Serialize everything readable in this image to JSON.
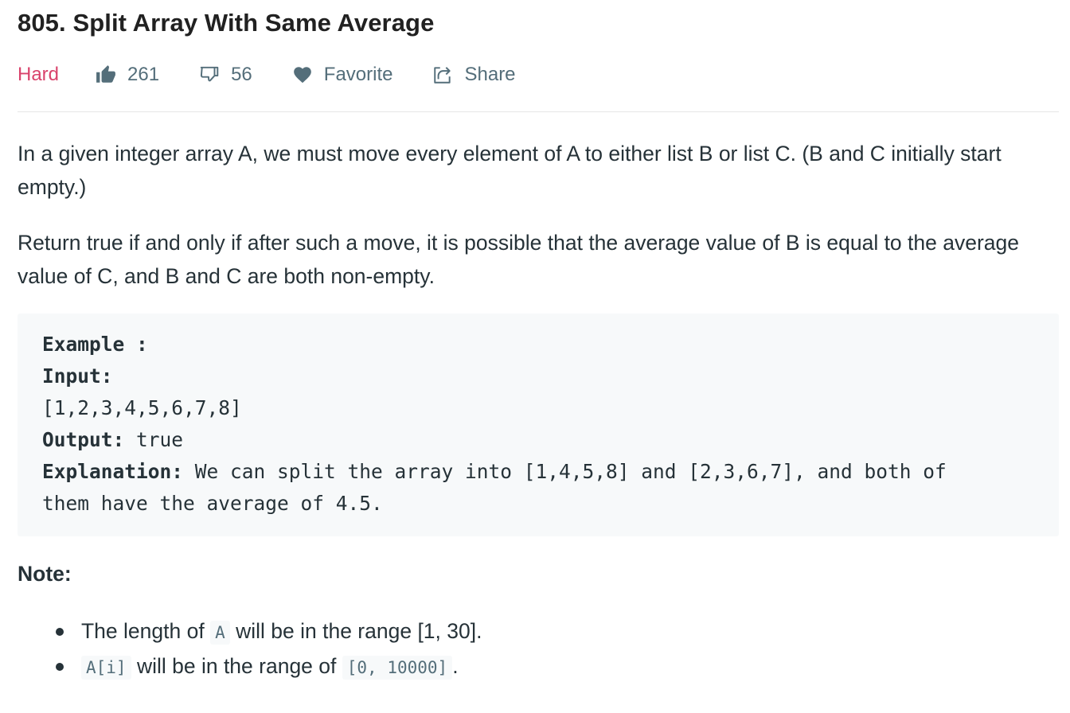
{
  "problem": {
    "title": "805. Split Array With Same Average",
    "difficulty": "Hard"
  },
  "toolbar": {
    "likes": "261",
    "dislikes": "56",
    "favorite_label": "Favorite",
    "share_label": "Share"
  },
  "colors": {
    "difficulty_hard": "#d9436c",
    "meta_text": "#546e7a",
    "body_text": "#263238",
    "code_background": "#f7f9fa"
  },
  "description": {
    "paragraph_1": "In a given integer array A, we must move every element of A to either list B or list C. (B and C initially start empty.)",
    "paragraph_2": "Return true if and only if after such a move, it is possible that the average value of B is equal to the average value of C, and B and C are both non-empty."
  },
  "example": {
    "heading": "Example :",
    "input_label": "Input:",
    "input_value": "[1,2,3,4,5,6,7,8]",
    "output_label": "Output:",
    "output_value": "true",
    "explanation_label": "Explanation:",
    "explanation_line_1": "We can split the array into [1,4,5,8] and [2,3,6,7], and both of",
    "explanation_line_2": "them have the average of 4.5."
  },
  "note": {
    "heading": "Note:",
    "bullet_1_before": "The length of",
    "bullet_1_code": "A",
    "bullet_1_after": "will be in the range [1, 30].",
    "bullet_2_code_1": "A[i]",
    "bullet_2_middle": "will be in the range of",
    "bullet_2_code_2": "[0, 10000]",
    "bullet_2_after": "."
  },
  "icons": [
    "thumbs-up-icon",
    "thumbs-down-icon",
    "heart-icon",
    "share-icon"
  ]
}
